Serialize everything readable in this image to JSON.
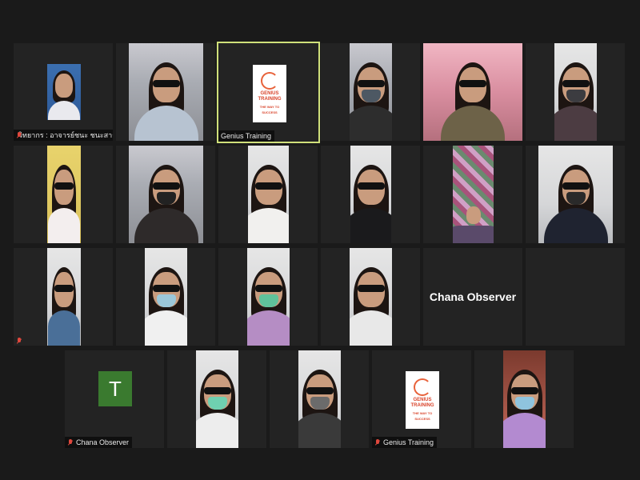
{
  "meeting": {
    "participants": [
      {
        "id": "p1",
        "name": "วิทยากร : อาจารย์ชนะ ชนะสาร",
        "muted": true,
        "type": "video"
      },
      {
        "id": "p2",
        "name": "",
        "muted": false,
        "type": "video"
      },
      {
        "id": "p3",
        "name": "Genius Training",
        "muted": false,
        "type": "logo",
        "active_speaker": true
      },
      {
        "id": "p4",
        "name": "",
        "muted": false,
        "type": "video"
      },
      {
        "id": "p5",
        "name": "",
        "muted": false,
        "type": "video"
      },
      {
        "id": "p6",
        "name": "",
        "muted": false,
        "type": "video"
      },
      {
        "id": "p7",
        "name": "",
        "muted": false,
        "type": "video"
      },
      {
        "id": "p8",
        "name": "",
        "muted": false,
        "type": "video"
      },
      {
        "id": "p9",
        "name": "",
        "muted": false,
        "type": "video"
      },
      {
        "id": "p10",
        "name": "",
        "muted": false,
        "type": "video"
      },
      {
        "id": "p11",
        "name": "",
        "muted": false,
        "type": "video"
      },
      {
        "id": "p12",
        "name": "",
        "muted": false,
        "type": "video"
      },
      {
        "id": "p13",
        "name": "",
        "muted": true,
        "type": "video"
      },
      {
        "id": "p14",
        "name": "",
        "muted": false,
        "type": "video"
      },
      {
        "id": "p15",
        "name": "",
        "muted": false,
        "type": "video"
      },
      {
        "id": "p16",
        "name": "",
        "muted": false,
        "type": "video"
      },
      {
        "id": "p17",
        "name": "Chana Observer",
        "muted": false,
        "type": "name-only"
      },
      {
        "id": "p18",
        "name": "",
        "muted": false,
        "type": "video"
      },
      {
        "id": "p19",
        "name": "Chana Observer",
        "muted": true,
        "type": "avatar",
        "avatar_letter": "T"
      },
      {
        "id": "p20",
        "name": "",
        "muted": false,
        "type": "video"
      },
      {
        "id": "p21",
        "name": "",
        "muted": false,
        "type": "video"
      },
      {
        "id": "p22",
        "name": "Genius Training",
        "muted": true,
        "type": "logo"
      },
      {
        "id": "p23",
        "name": "",
        "muted": false,
        "type": "video"
      }
    ],
    "logo_text_1": "GENIUS TRAINING",
    "logo_text_2": "THE WAY TO SUCCESS"
  },
  "colors": {
    "active_speaker_border": "#cfe07a",
    "muted_icon": "#e0483d",
    "avatar_bg": "#3a7a2f",
    "background": "#1a1a1a",
    "tile_bg": "#232323"
  }
}
